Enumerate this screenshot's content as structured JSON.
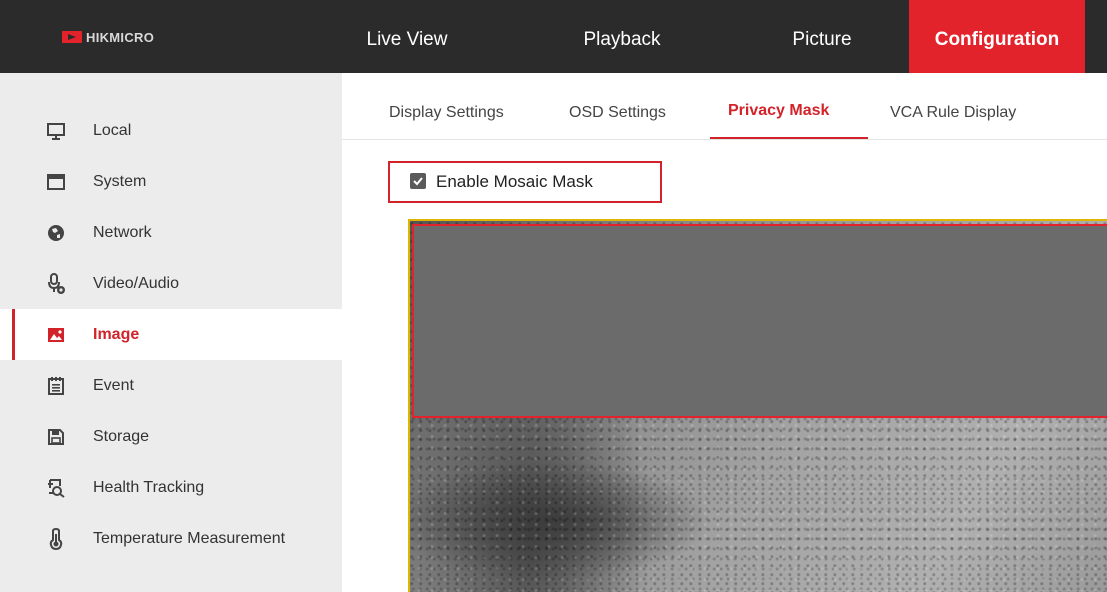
{
  "brand": {
    "name": "HIKMICRO",
    "accent": "#e3232b"
  },
  "topnav": {
    "items": [
      {
        "label": "Live View"
      },
      {
        "label": "Playback"
      },
      {
        "label": "Picture"
      },
      {
        "label": "Configuration",
        "active": true
      }
    ]
  },
  "sidebar": {
    "items": [
      {
        "label": "Local",
        "icon": "monitor-icon"
      },
      {
        "label": "System",
        "icon": "window-icon"
      },
      {
        "label": "Network",
        "icon": "globe-icon"
      },
      {
        "label": "Video/Audio",
        "icon": "microphone-icon"
      },
      {
        "label": "Image",
        "icon": "image-icon",
        "active": true
      },
      {
        "label": "Event",
        "icon": "calendar-icon"
      },
      {
        "label": "Storage",
        "icon": "save-icon"
      },
      {
        "label": "Health Tracking",
        "icon": "health-search-icon"
      },
      {
        "label": "Temperature Measurement",
        "icon": "thermometer-icon"
      }
    ]
  },
  "tabs": {
    "items": [
      {
        "label": "Display Settings"
      },
      {
        "label": "OSD Settings"
      },
      {
        "label": "Privacy Mask",
        "active": true
      },
      {
        "label": "VCA Rule Display"
      }
    ]
  },
  "privacy_mask": {
    "enable_label": "Enable Mosaic Mask",
    "enabled": true
  }
}
